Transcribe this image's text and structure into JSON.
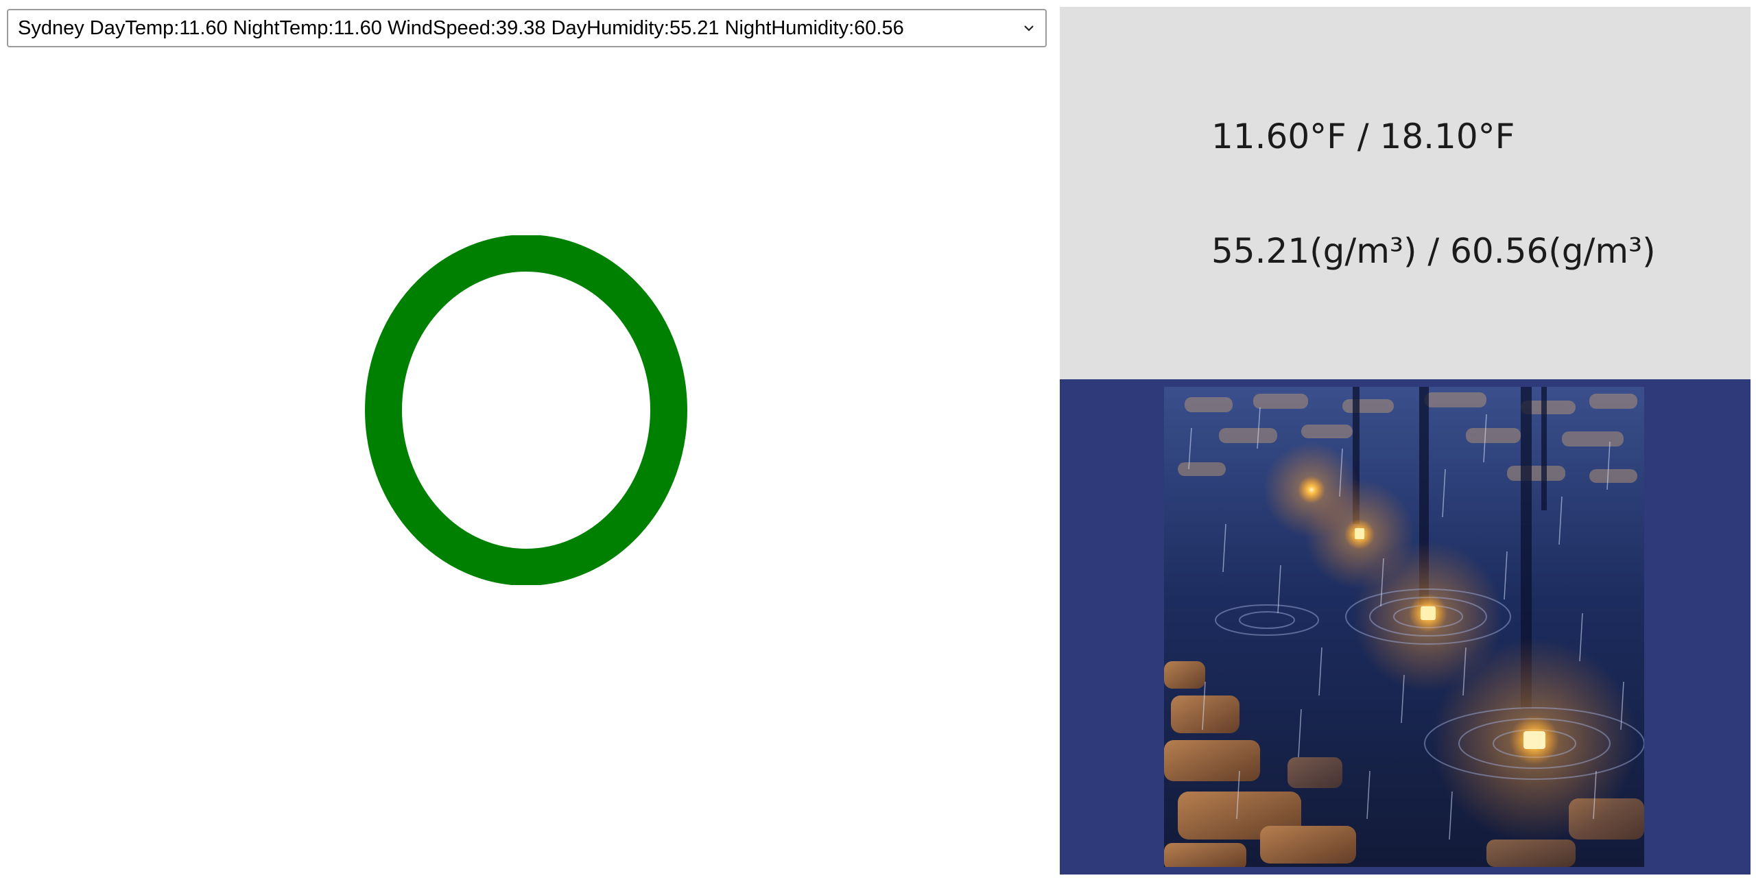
{
  "selector": {
    "selected_option": "Sydney DayTemp:11.60 NightTemp:11.60 WindSpeed:39.38 DayHumidity:55.21 NightHumidity:60.56"
  },
  "indicator": {
    "icon": "status-ring-icon",
    "color": "#008000"
  },
  "details": {
    "temperature": "11.60°F / 18.10°F",
    "humidity": "55.21(g/m³) / 60.56(g/m³)"
  },
  "weather_image": {
    "icon": "rainy-night-street-image"
  },
  "colors": {
    "info_panel_bg": "#e0e0e0",
    "image_panel_bg": "#2f3a7a",
    "indicator": "#008000"
  }
}
